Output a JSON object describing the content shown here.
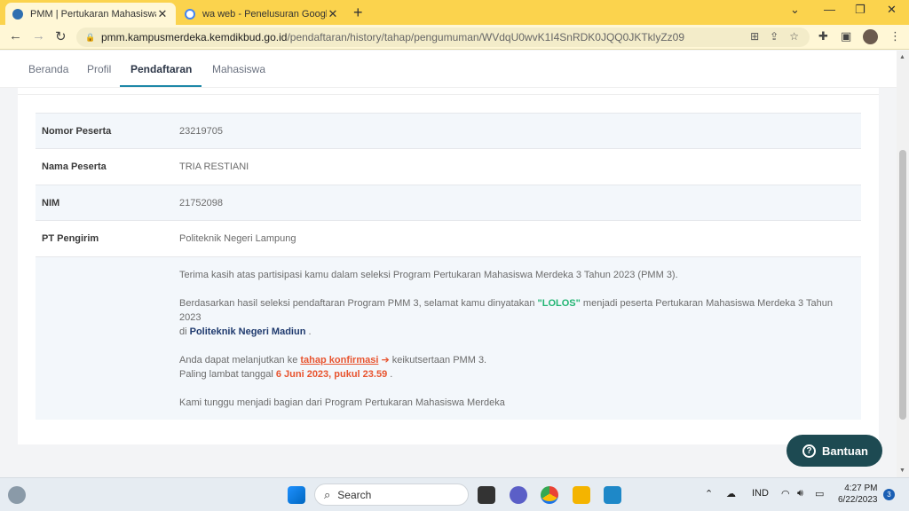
{
  "browser": {
    "tabs": [
      {
        "title": "PMM | Pertukaran Mahasiswa Merdeka",
        "active": true
      },
      {
        "title": "wa web - Penelusuran Google",
        "active": false
      }
    ],
    "url_host": "pmm.kampusmerdeka.kemdikbud.go.id",
    "url_path": "/pendaftaran/history/tahap/pengumuman/WVdqU0wvK1I4SnRDK0JQQ0JKTklyZz09"
  },
  "sitenav": {
    "items": [
      "Beranda",
      "Profil",
      "Pendaftaran",
      "Mahasiswa"
    ],
    "active": "Pendaftaran"
  },
  "details": [
    {
      "label": "Nomor Peserta",
      "value": "23219705"
    },
    {
      "label": "Nama Peserta",
      "value": "TRIA RESTIANI"
    },
    {
      "label": "NIM",
      "value": "21752098"
    },
    {
      "label": "PT Pengirim",
      "value": "Politeknik Negeri Lampung"
    }
  ],
  "announcement": {
    "line1": "Terima kasih atas partisipasi kamu dalam seleksi Program Pertukaran Mahasiswa Merdeka 3 Tahun 2023 (PMM 3).",
    "line2_pre": "Berdasarkan hasil seleksi pendaftaran Program PMM 3, selamat kamu dinyatakan ",
    "line2_status": "\"LOLOS\"",
    "line2_post": " menjadi peserta Pertukaran Mahasiswa Merdeka 3 Tahun 2023",
    "line3_pre": "di ",
    "line3_univ": "Politeknik Negeri Madiun",
    "line3_post": " .",
    "line4_pre": "Anda dapat melanjutkan ke ",
    "line4_link": "tahap konfirmasi",
    "line4_post": " keikutsertaan PMM 3.",
    "line5_pre": "Paling lambat tanggal ",
    "line5_deadline": "6 Juni 2023, pukul 23.59",
    "line5_post": " .",
    "line6": "Kami tunggu menjadi bagian dari Program Pertukaran Mahasiswa Merdeka"
  },
  "help_button": {
    "label": "Bantuan"
  },
  "taskbar": {
    "search_placeholder": "Search",
    "lang": "IND",
    "time": "4:27 PM",
    "date": "6/22/2023",
    "notifications": "3"
  },
  "colors": {
    "tab_strip": "#fbd34d",
    "accent": "#1e88a8",
    "status_green": "#22b573",
    "deadline_orange": "#e8542f",
    "help_button": "#1d4a52"
  }
}
